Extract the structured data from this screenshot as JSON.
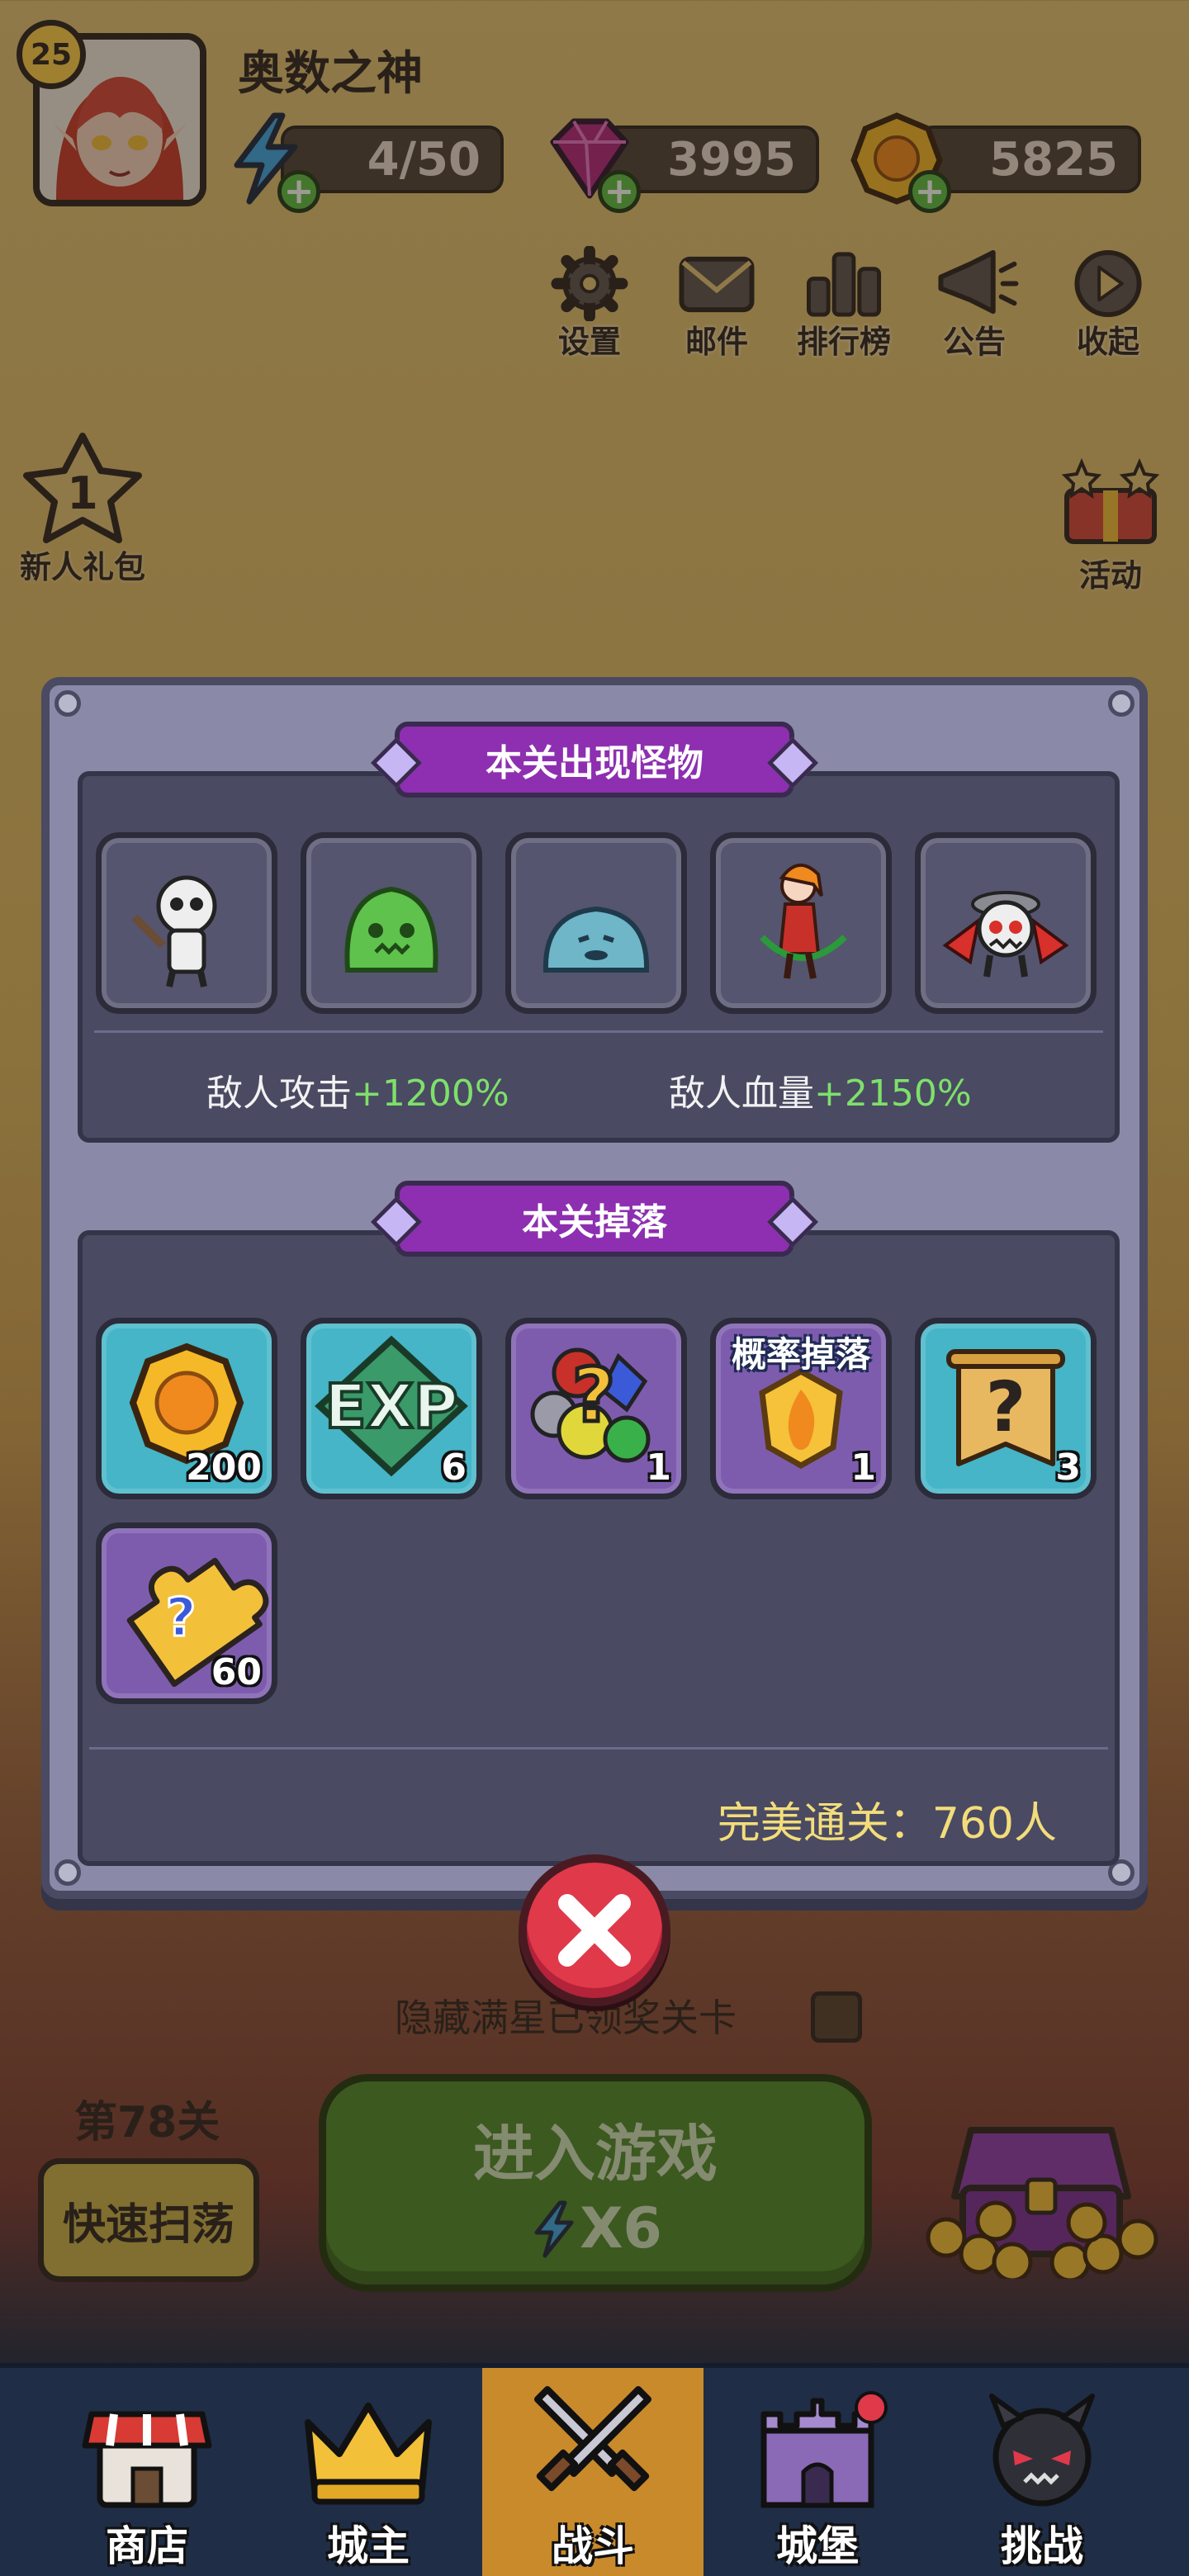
{
  "player": {
    "level": "25",
    "name": "奥数之神",
    "energy": "4/50",
    "gems": "3995",
    "gold": "5825"
  },
  "top_menu": [
    {
      "label": "设置",
      "icon": "gear-icon"
    },
    {
      "label": "邮件",
      "icon": "mail-icon"
    },
    {
      "label": "排行榜",
      "icon": "leaderboard-icon"
    },
    {
      "label": "公告",
      "icon": "megaphone-icon"
    },
    {
      "label": "收起",
      "icon": "collapse-icon"
    }
  ],
  "side": {
    "newbie_count": "1",
    "newbie_label": "新人礼包",
    "event_label": "活动"
  },
  "modal": {
    "monsters_title": "本关出现怪物",
    "monsters": [
      "skeleton-swordsman",
      "green-slime",
      "blue-slime",
      "elf-archer",
      "skull-bat"
    ],
    "enemy_attack_label": "敌人攻击",
    "enemy_attack_value": "+1200%",
    "enemy_hp_label": "敌人血量",
    "enemy_hp_value": "+2150%",
    "drops_title": "本关掉落",
    "drops": [
      {
        "item": "gold-coin",
        "count": "200"
      },
      {
        "item": "exp",
        "label": "EXP",
        "count": "6"
      },
      {
        "item": "random-gem",
        "count": "1"
      },
      {
        "item": "fire-crystal",
        "badge": "概率掉落",
        "count": "1"
      },
      {
        "item": "mystery-scroll",
        "count": "3"
      },
      {
        "item": "puzzle-piece",
        "count": "60"
      }
    ],
    "perfect_clear": "完美通关：760人"
  },
  "bottom": {
    "hide_label": "隐藏满星已领奖关卡",
    "stage_label": "第78关",
    "sweep_label": "快速扫荡",
    "enter_label": "进入游戏",
    "energy_cost": "X6"
  },
  "nav": [
    {
      "label": "商店",
      "icon": "shop-icon"
    },
    {
      "label": "城主",
      "icon": "crown-icon"
    },
    {
      "label": "战斗",
      "icon": "swords-icon",
      "active": true
    },
    {
      "label": "城堡",
      "icon": "castle-icon"
    },
    {
      "label": "挑战",
      "icon": "demon-icon"
    }
  ],
  "colors": {
    "accent_purple": "#8d2fb0",
    "positive_green": "#7ee06a",
    "close_red": "#e0394a",
    "enter_green": "#4d8a2a"
  }
}
